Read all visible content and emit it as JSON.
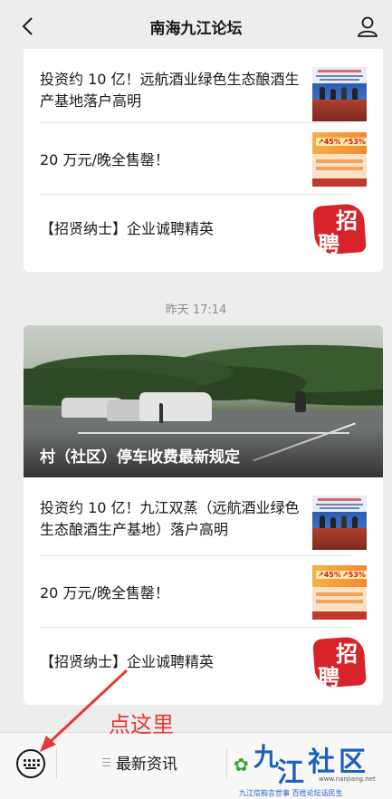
{
  "nav": {
    "title": "南海九江论坛"
  },
  "card1": {
    "items": [
      {
        "title": "投资约 10 亿！远航酒业绿色生态酿酒生产基地落户高明",
        "thumb": "news-photo-thumbnail"
      },
      {
        "title": "20 万元/晚全售罄！",
        "thumb": "price-poster-thumbnail",
        "thumb_text": [
          "↗45%",
          "↗53%"
        ]
      },
      {
        "title": "【招贤纳士】企业诚聘精英",
        "thumb": "recruit-stamp-thumbnail",
        "thumb_text": [
          "招",
          "聘"
        ]
      }
    ]
  },
  "timestamp": "昨天 17:14",
  "card2": {
    "hero_caption": "村（社区）停车收费最新规定",
    "items": [
      {
        "title": "投资约 10 亿！九江双蒸（远航酒业绿色生态酿酒生产基地）落户高明",
        "thumb": "news-photo-thumbnail"
      },
      {
        "title": "20 万元/晚全售罄！",
        "thumb": "price-poster-thumbnail",
        "thumb_text": [
          "↗45%",
          "↗53%"
        ]
      },
      {
        "title": "【招贤纳士】企业诚聘精英",
        "thumb": "recruit-stamp-thumbnail",
        "thumb_text": [
          "招",
          "聘"
        ]
      }
    ]
  },
  "annotation": "点这里",
  "bottom_bar": {
    "menu_label": "最新资讯",
    "logo_text": [
      "九",
      "江",
      "社",
      "区"
    ],
    "logo_url": "www.nanjiang.net",
    "logo_slogan": "九江信韵言世事  百姓论坛话民生"
  },
  "colors": {
    "accent_red": "#e53935",
    "logo_blue": "#1f5fbf",
    "recruit_red": "#d8232a"
  }
}
